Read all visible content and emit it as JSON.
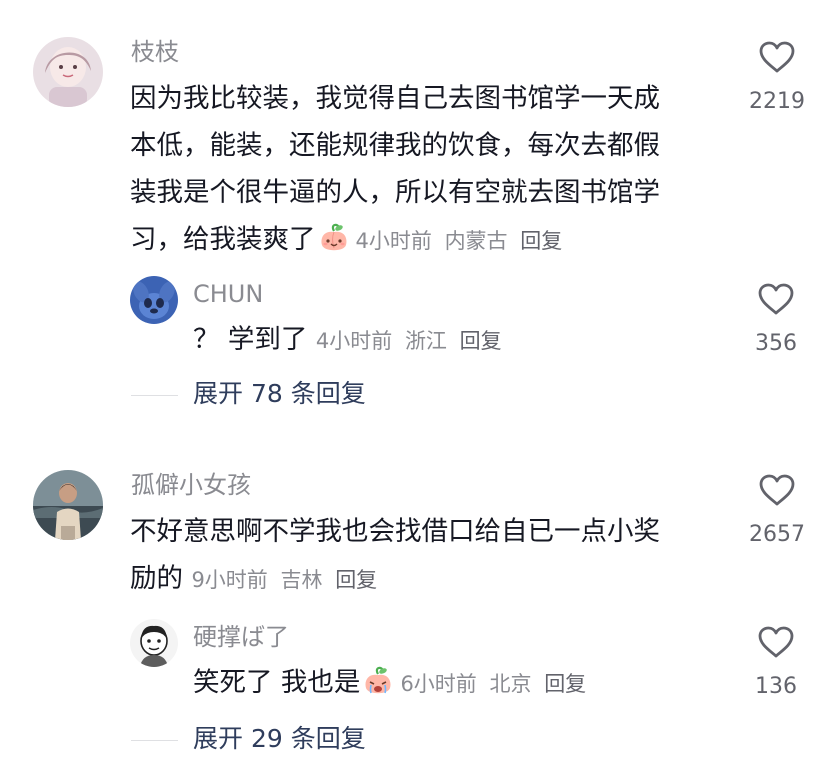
{
  "comments": [
    {
      "username": "枝枝",
      "lines": [
        "因为我比较装，我觉得自己去图书馆学一天成",
        "本低，能装，还能规律我的饮食，每次去都假",
        "装我是个很牛逼的人，所以有空就去图书馆学",
        "习，给我装爽了"
      ],
      "emoji": "peach-smile-emoji",
      "time": "4小时前",
      "location": "内蒙古",
      "reply_label": "回复",
      "likes": "2219",
      "replies": [
        {
          "username": "CHUN",
          "text": "？ 学到了",
          "time": "4小时前",
          "location": "浙江",
          "reply_label": "回复",
          "likes": "356"
        }
      ],
      "expand_label": "展开 78 条回复"
    },
    {
      "username": "孤僻小女孩",
      "lines": [
        "不好意思啊不学我也会找借口给自已一点小奖",
        "励的"
      ],
      "time": "9小时前",
      "location": "吉林",
      "reply_label": "回复",
      "likes": "2657",
      "replies": [
        {
          "username": "硬撑ば了",
          "text": "笑死了 我也是",
          "emoji": "peach-cry-emoji",
          "time": "6小时前",
          "location": "北京",
          "reply_label": "回复",
          "likes": "136"
        }
      ],
      "expand_label": "展开 29 条回复"
    }
  ],
  "colors": {
    "primary_text": "#161823",
    "secondary_text": "#8a8b91",
    "expand_text": "#2f3d5c",
    "heart_outline": "#62636b"
  }
}
